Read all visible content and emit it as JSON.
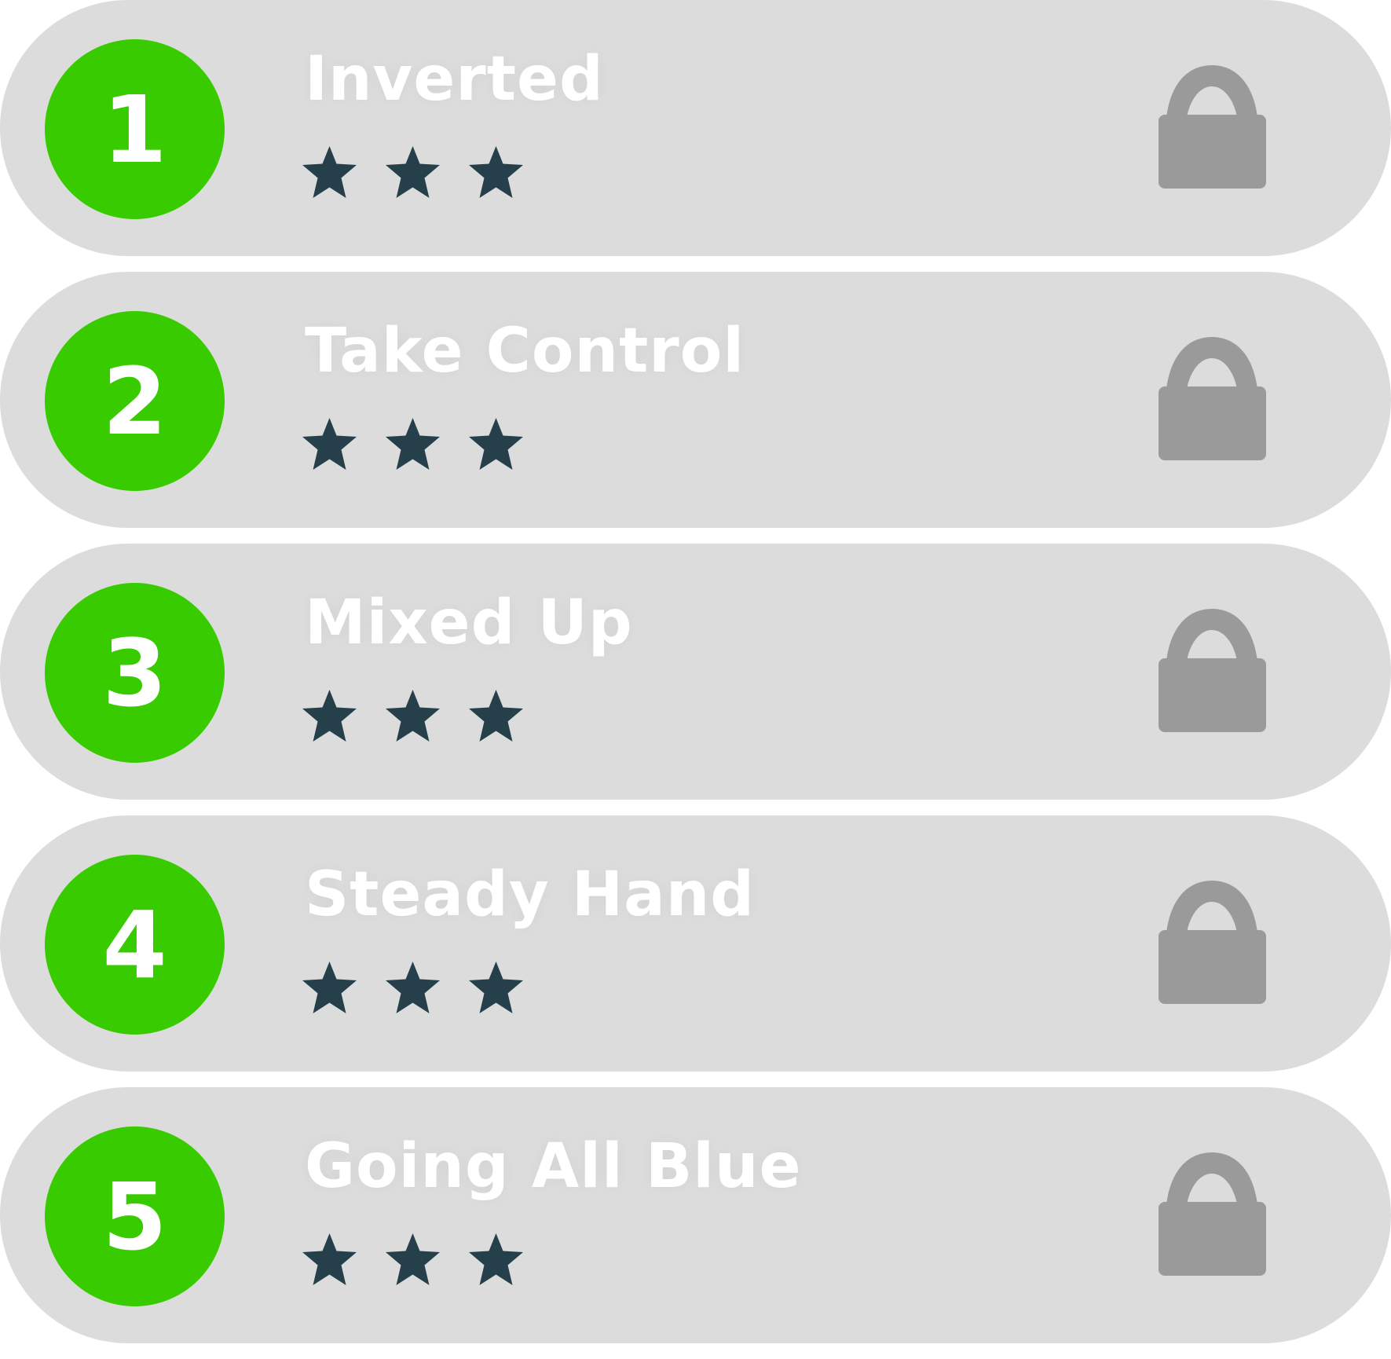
{
  "colors": {
    "row_background": "#dcdcdc",
    "badge": "#38cb00",
    "text": "#ffffff",
    "star": "#25404a",
    "lock": "#9a9a9a"
  },
  "levels": [
    {
      "number": "1",
      "title": "Inverted",
      "stars": 3,
      "locked": true,
      "lock_icon": "lock-icon",
      "star_icon": "star-icon"
    },
    {
      "number": "2",
      "title": "Take Control",
      "stars": 3,
      "locked": true,
      "lock_icon": "lock-icon",
      "star_icon": "star-icon"
    },
    {
      "number": "3",
      "title": "Mixed Up",
      "stars": 3,
      "locked": true,
      "lock_icon": "lock-icon",
      "star_icon": "star-icon"
    },
    {
      "number": "4",
      "title": "Steady Hand",
      "stars": 3,
      "locked": true,
      "lock_icon": "lock-icon",
      "star_icon": "star-icon"
    },
    {
      "number": "5",
      "title": "Going All Blue",
      "stars": 3,
      "locked": true,
      "lock_icon": "lock-icon",
      "star_icon": "star-icon"
    }
  ]
}
